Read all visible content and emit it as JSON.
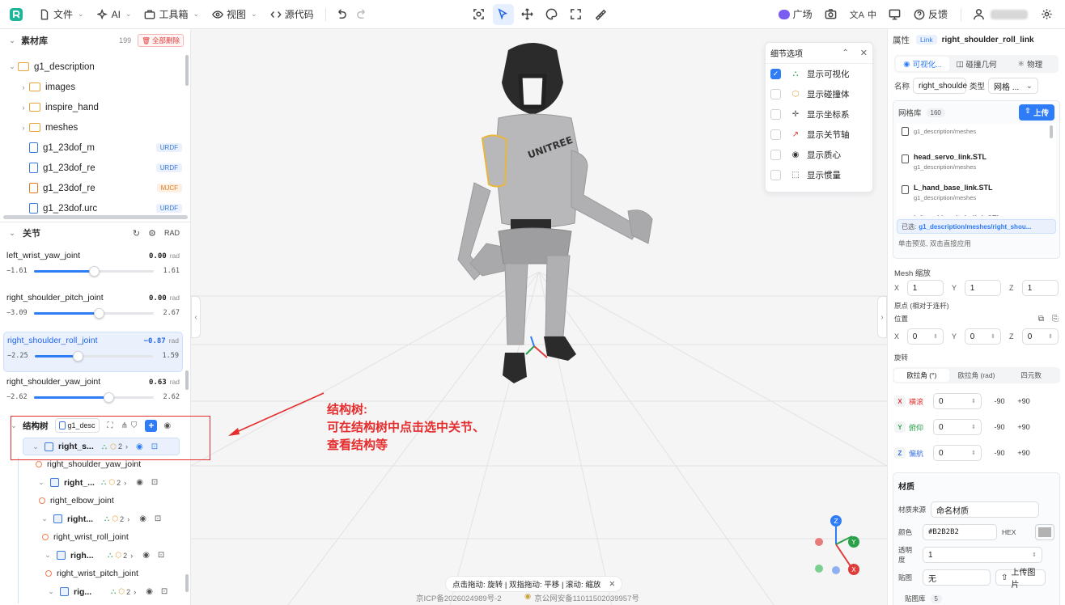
{
  "toolbar": {
    "file": "文件",
    "ai": "AI",
    "toolbox": "工具箱",
    "view": "视图",
    "source": "源代码",
    "plaza": "广场",
    "lang": "中",
    "feedback": "反馈"
  },
  "assets": {
    "title": "素材库",
    "count": "199",
    "delete_all": "全部删除",
    "root": "g1_description",
    "folders": [
      "images",
      "inspire_hand",
      "meshes"
    ],
    "files": [
      {
        "name": "g1_23dof_m",
        "tag": "URDF"
      },
      {
        "name": "g1_23dof_re",
        "tag": "URDF"
      },
      {
        "name": "g1_23dof_re",
        "tag": "MJCF"
      },
      {
        "name": "g1_23dof.urc",
        "tag": "URDF"
      }
    ]
  },
  "joints": {
    "title": "关节",
    "unit_mode": "RAD",
    "unit": "rad",
    "items": [
      {
        "name": "left_wrist_yaw_joint",
        "value": "0.00",
        "min": "−1.61",
        "max": "1.61",
        "pos": 0.5
      },
      {
        "name": "right_shoulder_pitch_joint",
        "value": "0.00",
        "min": "−3.09",
        "max": "2.67",
        "pos": 0.54
      },
      {
        "name": "right_shoulder_roll_joint",
        "value": "−0.87",
        "min": "−2.25",
        "max": "1.59",
        "pos": 0.36
      },
      {
        "name": "right_shoulder_yaw_joint",
        "value": "0.63",
        "min": "−2.62",
        "max": "2.62",
        "pos": 0.62
      }
    ]
  },
  "structure": {
    "title": "结构树",
    "root_chip": "g1_desc",
    "selected_node": "right_s...",
    "nodes": [
      {
        "joint": "right_shoulder_yaw_joint",
        "link": "right_..."
      },
      {
        "joint": "right_elbow_joint",
        "link": "right..."
      },
      {
        "joint": "right_wrist_roll_joint",
        "link": "righ..."
      },
      {
        "joint": "right_wrist_pitch_joint",
        "link": "rig..."
      }
    ],
    "badge_count": "2"
  },
  "annotation": {
    "title": "结构树:",
    "line1": "可在结构树中点击选中关节、",
    "line2": "查看结构等"
  },
  "detail_options": {
    "title": "细节选项",
    "items": [
      {
        "label": "显示可视化",
        "checked": true
      },
      {
        "label": "显示碰撞体",
        "checked": false
      },
      {
        "label": "显示坐标系",
        "checked": false
      },
      {
        "label": "显示关节轴",
        "checked": false
      },
      {
        "label": "显示质心",
        "checked": false
      },
      {
        "label": "显示惯量",
        "checked": false
      }
    ]
  },
  "viewport": {
    "hint": "点击拖动: 旋转 | 双指拖动: 平移 | 滚动: 缩放",
    "icp": "京ICP备2026024989号-2",
    "police": "京公网安备11011502039957号",
    "logo_text": "UNITREE"
  },
  "properties": {
    "title": "属性",
    "type_chip": "Link",
    "link_name": "right_shoulder_roll_link",
    "tabs": [
      "可视化...",
      "碰撞几何",
      "物理"
    ],
    "name_label": "名称",
    "name_value": "right_shoulde",
    "type_label": "类型",
    "type_value": "网格 ...",
    "mesh_lib": "网格库",
    "mesh_count": "160",
    "upload": "上传",
    "meshes": [
      {
        "name": "",
        "path": "g1_description/meshes"
      },
      {
        "name": "head_servo_link.STL",
        "path": "g1_description/meshes"
      },
      {
        "name": "L_hand_base_link.STL",
        "path": "g1_description/meshes"
      },
      {
        "name": "left_ankle_pitch_link.STL",
        "path": ""
      }
    ],
    "selected_label": "已选:",
    "selected_path": "g1_description/meshes/right_shou...",
    "hint": "单击预览, 双击直接应用",
    "mesh_scale": "Mesh 缩放",
    "scale": [
      "1",
      "1",
      "1"
    ],
    "origin_label": "原点 (相对于连杆)",
    "position_label": "位置",
    "position": [
      "0",
      "0",
      "0"
    ],
    "rotation_label": "旋转",
    "rot_tabs": [
      "欧拉角 (°)",
      "欧拉角 (rad)",
      "四元数"
    ],
    "euler": [
      {
        "axis": "X",
        "name": "横滚",
        "value": "0",
        "color": "#e03b3b"
      },
      {
        "axis": "Y",
        "name": "俯仰",
        "value": "0",
        "color": "#2aa14a"
      },
      {
        "axis": "Z",
        "name": "偏航",
        "value": "0",
        "color": "#3b6fe0"
      }
    ],
    "minus90": "-90",
    "plus90": "+90",
    "material_title": "材质",
    "material_source_label": "材质来源",
    "material_source": "命名材质",
    "color_label": "颜色",
    "color_value": "#B2B2B2",
    "color_format": "HEX",
    "opacity_label": "透明度",
    "opacity": "1",
    "texture_label": "贴图",
    "texture": "无",
    "upload_image": "上传图片",
    "texture_lib": "贴图库",
    "texture_count": "5"
  },
  "colors": {
    "accent": "#2e7cf6",
    "annotation": "#e52d2d",
    "robot_body": "#b2b2b2",
    "robot_dark": "#2b2b2b"
  }
}
